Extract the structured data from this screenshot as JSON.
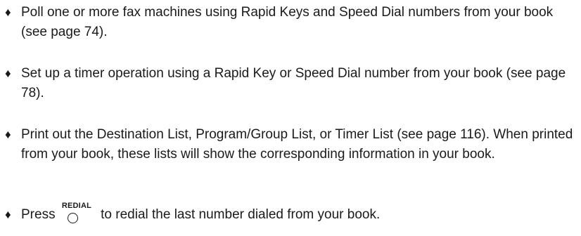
{
  "bullets": [
    {
      "marker": "♦",
      "text": "Poll one or more fax machines using Rapid Keys and Speed Dial numbers from your book (see page 74)."
    },
    {
      "marker": "♦",
      "text": "Set up a timer operation using a Rapid Key or Speed Dial number from your book (see page 78)."
    },
    {
      "marker": "♦",
      "text": "Print out the Destination List, Program/Group List, or Timer List (see page 116). When printed from your book, these lists will show the corresponding information in your book."
    },
    {
      "marker": "♦",
      "before_key": "Press ",
      "key_label": "REDIAL",
      "after_key": " to redial the last number dialed from your book."
    }
  ],
  "icons": {
    "bullet": "diamond-bullet-icon",
    "redial_key": "round-button-icon"
  }
}
